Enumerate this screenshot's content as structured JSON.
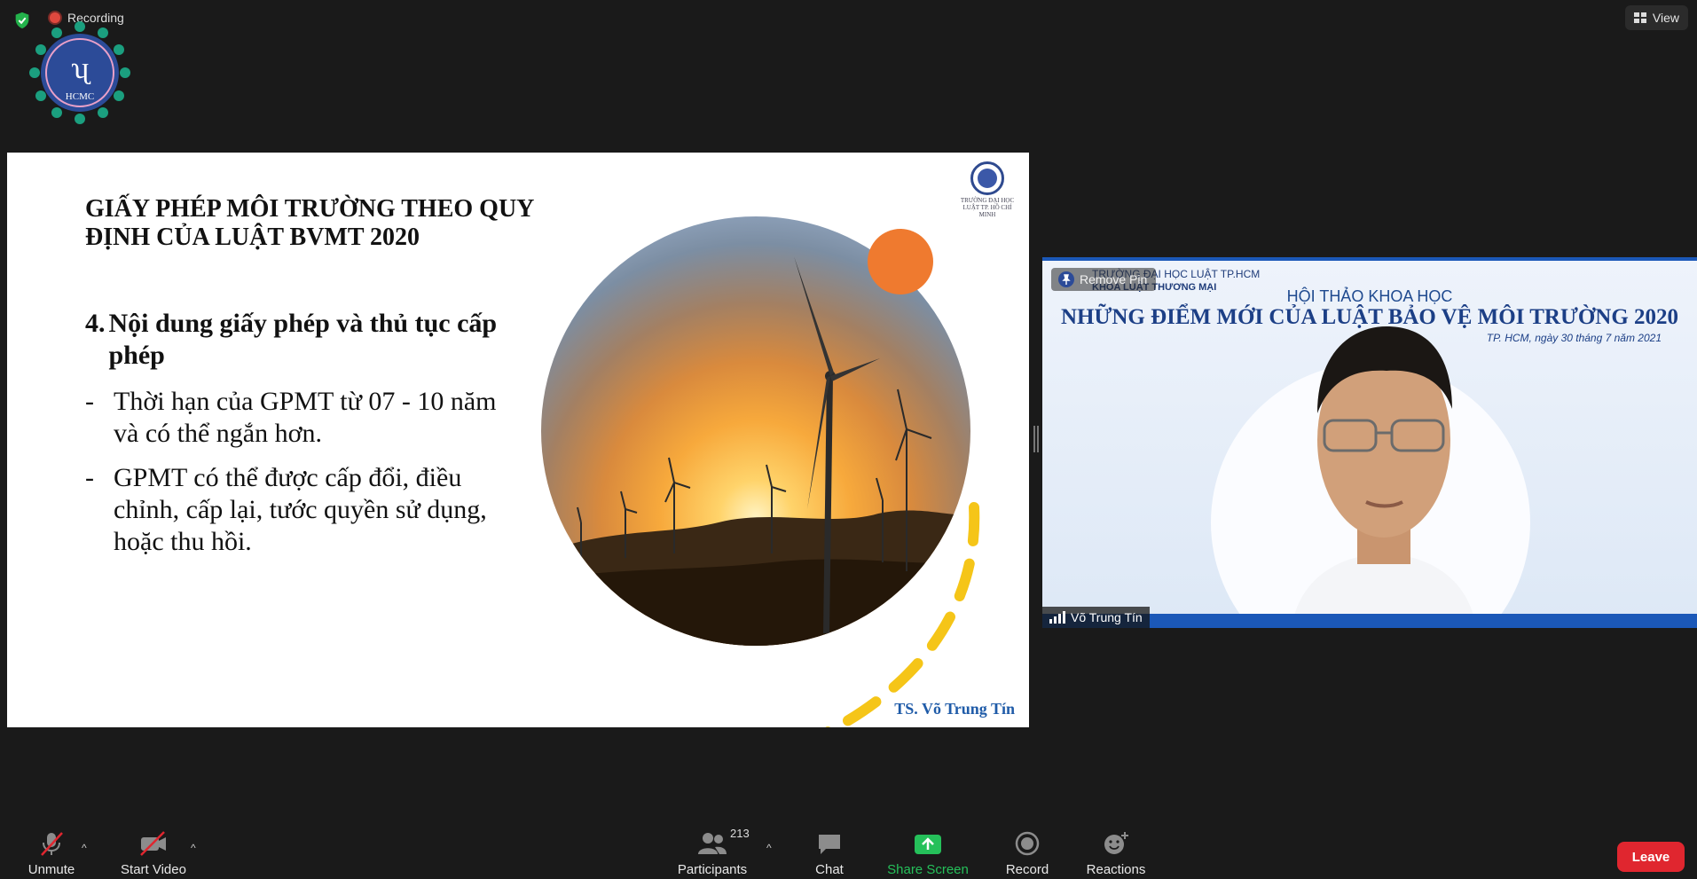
{
  "top_bar": {
    "recording_label": "Recording",
    "view_label": "View"
  },
  "watermark_logo": {
    "text": "HCMC"
  },
  "slide": {
    "title": "GIẤY PHÉP MÔI TRƯỜNG THEO QUY ĐỊNH CỦA LUẬT BVMT 2020",
    "heading_number": "4.",
    "heading_text": "Nội dung giấy phép và thủ tục cấp phép",
    "bullets": [
      "Thời hạn của GPMT từ  07 - 10 năm và có thể ngắn hơn.",
      "GPMT có thể được cấp đổi, điều chỉnh, cấp lại, tước quyền sử dụng, hoặc thu hồi."
    ],
    "bullet_marker": "-",
    "mini_logo_caption": "TRƯỜNG ĐẠI HỌC LUẬT TP. HỒ CHÍ MINH",
    "author": "TS. Võ Trung Tín"
  },
  "video": {
    "header_line1": "TRƯỜNG ĐẠI HỌC LUẬT TP.HCM",
    "header_line2": "KHOA LUẬT THƯƠNG MẠI",
    "subtitle": "HỘI THẢO KHOA HỌC",
    "title": "NHỮNG ĐIỂM MỚI CỦA LUẬT BẢO VỆ MÔI TRƯỜNG 2020",
    "date": "TP. HCM, ngày 30 tháng 7 năm 2021",
    "remove_pin_label": "Remove Pin",
    "participant_name": "Võ Trung Tín"
  },
  "toolbar": {
    "unmute_label": "Unmute",
    "start_video_label": "Start Video",
    "participants_label": "Participants",
    "participants_count": "213",
    "chat_label": "Chat",
    "share_screen_label": "Share Screen",
    "record_label": "Record",
    "reactions_label": "Reactions",
    "leave_label": "Leave",
    "caret": "^"
  },
  "colors": {
    "share_green": "#25c05a",
    "leave_red": "#e0262f",
    "slide_accent_blue": "#1f5ba8",
    "sun_orange": "#ef7a2f",
    "dash_yellow": "#f5c518"
  }
}
